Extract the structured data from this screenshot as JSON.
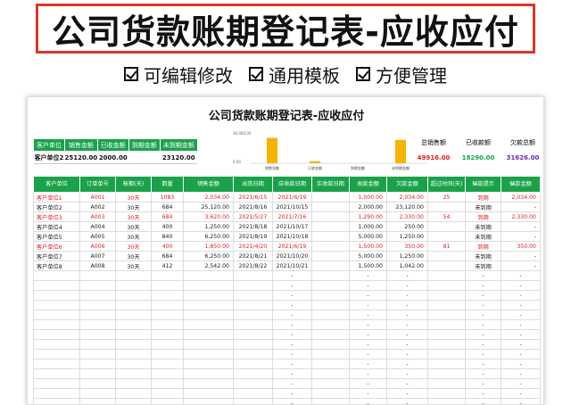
{
  "banner": {
    "title": "公司货款账期登记表-应收应付"
  },
  "features": [
    "可编辑修改",
    "通用模板",
    "方便管理"
  ],
  "sheet_title": "公司货款账期登记表-应收应付",
  "summary": {
    "headers": [
      "客户单位",
      "销售金额",
      "已收金额",
      "到期金额",
      "未到期金额"
    ],
    "values": [
      "客户单位2",
      "25120.00",
      "2000.00",
      "",
      "23120.00"
    ]
  },
  "chart": {
    "ytick_top": "30,000.00",
    "ytick_bottom": "0.00",
    "labels": [
      "销售金额",
      "已收金额",
      "到期金额",
      "未到期金额"
    ],
    "values": [
      25120,
      2000,
      0,
      23120
    ],
    "bar_color": "#f5b400"
  },
  "totals": {
    "labels": [
      "总销售额",
      "已收款额",
      "欠款总额"
    ],
    "values": [
      "49916.00",
      "18290.00",
      "31626.00"
    ],
    "colors": [
      "#e02020",
      "#1aa24a",
      "#6a2bb0"
    ]
  },
  "table": {
    "headers": [
      "客户单位",
      "订单单号",
      "帐期(天)",
      "数量",
      "销售金额",
      "出货日期",
      "应收款日期",
      "实收款日期",
      "收款金额",
      "欠款金额",
      "超过时间(天)",
      "催款提示",
      "催款金额"
    ],
    "rows": [
      {
        "red": true,
        "cells": [
          "客户单位1",
          "A001",
          "30天",
          "1083",
          "2,034.00",
          "2021/6/15",
          "2021/6/19",
          "",
          "1,000.00",
          "2,034.00",
          "25",
          "到期",
          "2,034.00"
        ]
      },
      {
        "red": false,
        "cells": [
          "客户单位2",
          "A002",
          "30天",
          "684",
          "25,120.00",
          "2021/8/16",
          "2021/10/15",
          "",
          "2,000.00",
          "23,120.00",
          "",
          "未到期",
          "-"
        ]
      },
      {
        "red": true,
        "cells": [
          "客户单位3",
          "A003",
          "30天",
          "684",
          "3,620.00",
          "2021/5/27",
          "2021/7/16",
          "",
          "1,290.00",
          "2,330.00",
          "54",
          "到期",
          "2,330.00"
        ]
      },
      {
        "red": false,
        "cells": [
          "客户单位4",
          "A004",
          "30天",
          "400",
          "1,250.00",
          "2021/8/18",
          "2021/10/17",
          "",
          "1,000.00",
          "250.00",
          "",
          "未到期",
          "-"
        ]
      },
      {
        "red": false,
        "cells": [
          "客户单位5",
          "A005",
          "30天",
          "840",
          "6,250.00",
          "2021/8/19",
          "2021/10/18",
          "",
          "5,000.00",
          "1,250.00",
          "",
          "未到期",
          "-"
        ]
      },
      {
        "red": true,
        "cells": [
          "客户单位6",
          "A006",
          "30天",
          "400",
          "1,850.00",
          "2021/4/20",
          "2021/6/19",
          "",
          "1,500.00",
          "350.00",
          "81",
          "到期",
          "350.00"
        ]
      },
      {
        "red": false,
        "cells": [
          "客户单位7",
          "A007",
          "30天",
          "684",
          "6,250.00",
          "2021/8/21",
          "2021/10/20",
          "",
          "5,000.00",
          "1,250.00",
          "",
          "未到期",
          "-"
        ]
      },
      {
        "red": false,
        "cells": [
          "客户单位8",
          "A008",
          "30天",
          "412",
          "2,542.00",
          "2021/8/22",
          "2021/10/21",
          "",
          "1,500.00",
          "1,042.00",
          "",
          "未到期",
          "-"
        ]
      }
    ],
    "empty_placeholder": "-"
  }
}
